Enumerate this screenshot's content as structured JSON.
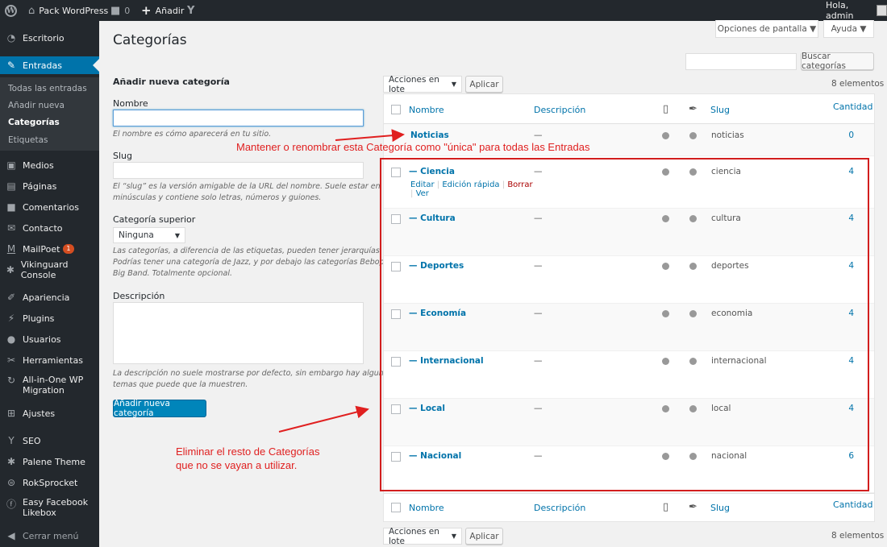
{
  "adminbar": {
    "site": "Pack WordPress",
    "comments": "0",
    "new": "Añadir",
    "greeting": "Hola, admin"
  },
  "sidebar": {
    "items": [
      {
        "label": "Escritorio",
        "icon": "dashboard-icon"
      },
      {
        "label": "Entradas",
        "icon": "pin-icon"
      },
      {
        "label": "Medios",
        "icon": "media-icon"
      },
      {
        "label": "Páginas",
        "icon": "pages-icon"
      },
      {
        "label": "Comentarios",
        "icon": "comments-icon"
      },
      {
        "label": "Contacto",
        "icon": "mail-icon"
      },
      {
        "label": "MailPoet",
        "icon": "mailpoet-icon",
        "badge": "1"
      },
      {
        "label": "Vikinguard Console",
        "icon": "gear-icon"
      },
      {
        "label": "Apariencia",
        "icon": "brush-icon"
      },
      {
        "label": "Plugins",
        "icon": "plug-icon"
      },
      {
        "label": "Usuarios",
        "icon": "user-icon"
      },
      {
        "label": "Herramientas",
        "icon": "wrench-icon"
      },
      {
        "label": "All-in-One WP",
        "label2": "Migration",
        "icon": "migration-icon"
      },
      {
        "label": "Ajustes",
        "icon": "settings-icon"
      },
      {
        "label": "SEO",
        "icon": "yoast-icon"
      },
      {
        "label": "Palene Theme",
        "icon": "gear-icon"
      },
      {
        "label": "RokSprocket",
        "icon": "rok-icon"
      },
      {
        "label": "Easy Facebook",
        "label2": "Likebox",
        "icon": "facebook-icon"
      },
      {
        "label": "Cerrar menú",
        "icon": "collapse-icon"
      }
    ],
    "sub": [
      "Todas las entradas",
      "Añadir nueva",
      "Categorías",
      "Etiquetas"
    ]
  },
  "page": {
    "title": "Categorías",
    "screen_options": "Opciones de pantalla ▼",
    "help": "Ayuda ▼",
    "search_button": "Buscar categorías",
    "bulk": "Acciones en lote",
    "apply": "Aplicar",
    "count": "8 elementos"
  },
  "form": {
    "heading": "Añadir nueva categoría",
    "name_label": "Nombre",
    "name_hint": "El nombre es cómo aparecerá en tu sitio.",
    "slug_label": "Slug",
    "slug_hint1": "El “slug” es la versión amigable de la URL del nombre. Suele estar en",
    "slug_hint2": "minúsculas y contiene solo letras, números y guiones.",
    "parent_label": "Categoría superior",
    "parent_value": "Ninguna",
    "parent_hint1": "Las categorías, a diferencia de las etiquetas, pueden tener jerarquías.",
    "parent_hint2": "Podrías tener una categoría de Jazz, y por debajo las categorías Bebop y",
    "parent_hint3": "Big Band. Totalmente opcional.",
    "desc_label": "Descripción",
    "desc_hint1": "La descripción no suele mostrarse por defecto, sin embargo hay algunos",
    "desc_hint2": "temas que puede que la muestren.",
    "submit": "Añadir nueva categoría"
  },
  "table": {
    "headers": {
      "name": "Nombre",
      "description": "Descripción",
      "slug": "Slug",
      "count": "Cantidad"
    },
    "rows": [
      {
        "name": "Noticias",
        "desc": "—",
        "slug": "noticias",
        "count": "0"
      },
      {
        "name": "— Ciencia",
        "desc": "—",
        "slug": "ciencia",
        "count": "4"
      },
      {
        "name": "— Cultura",
        "desc": "—",
        "slug": "cultura",
        "count": "4"
      },
      {
        "name": "— Deportes",
        "desc": "—",
        "slug": "deportes",
        "count": "4"
      },
      {
        "name": "— Economía",
        "desc": "—",
        "slug": "economia",
        "count": "4"
      },
      {
        "name": "— Internacional",
        "desc": "—",
        "slug": "internacional",
        "count": "4"
      },
      {
        "name": "— Local",
        "desc": "—",
        "slug": "local",
        "count": "4"
      },
      {
        "name": "— Nacional",
        "desc": "—",
        "slug": "nacional",
        "count": "6"
      }
    ],
    "row_actions": {
      "edit": "Editar",
      "quick": "Edición rápida",
      "delete": "Borrar",
      "view": "Ver"
    }
  },
  "annotations": {
    "top": "Mantener o renombrar esta Categoría como \"única\" para todas las Entradas",
    "bottom1": "Eliminar el resto de Categorías",
    "bottom2": "que no se vayan a utilizar.",
    "color": "#e02020"
  }
}
